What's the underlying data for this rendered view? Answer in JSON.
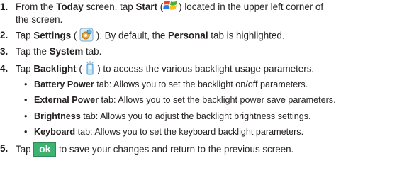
{
  "steps": [
    {
      "num": "1.",
      "a": "From the ",
      "b1": "Today",
      "c": " screen, tap ",
      "b2": "Start",
      "d": " (",
      "e": ") located in the upper left corner of",
      "line2": "the screen.",
      "icon": "windows-start-flag-icon"
    },
    {
      "num": "2.",
      "a": "Tap ",
      "b1": "Settings",
      "c": " ( ",
      "d": " ). By default, the ",
      "b2": "Personal",
      "e": " tab is highlighted.",
      "icon": "settings-gear-icon"
    },
    {
      "num": "3.",
      "a": "Tap the ",
      "b1": "System",
      "c": " tab."
    },
    {
      "num": "4.",
      "a": "Tap ",
      "b1": "Backlight",
      "c": " ( ",
      "d": " ) to access the various backlight usage parameters.",
      "icon": "backlight-phone-icon"
    },
    {
      "num": "5.",
      "a": "Tap ",
      "ok": "ok",
      "b": " to save your changes and return to the previous screen."
    }
  ],
  "bullets": [
    {
      "bold": "Battery Power",
      "text": " tab: Allows you to set the backlight on/off parameters."
    },
    {
      "bold": "External Power",
      "text": " tab: Allows you to set the backlight power save parameters."
    },
    {
      "bold": "Brightness",
      "text": " tab: Allows you to adjust the backlight brightness settings."
    },
    {
      "bold": "Keyboard",
      "text": " tab: Allows you to set the keyboard backlight parameters."
    }
  ],
  "bullet_char": "•",
  "colors": {
    "ok_button": "#3cb371",
    "text": "#231f20"
  }
}
